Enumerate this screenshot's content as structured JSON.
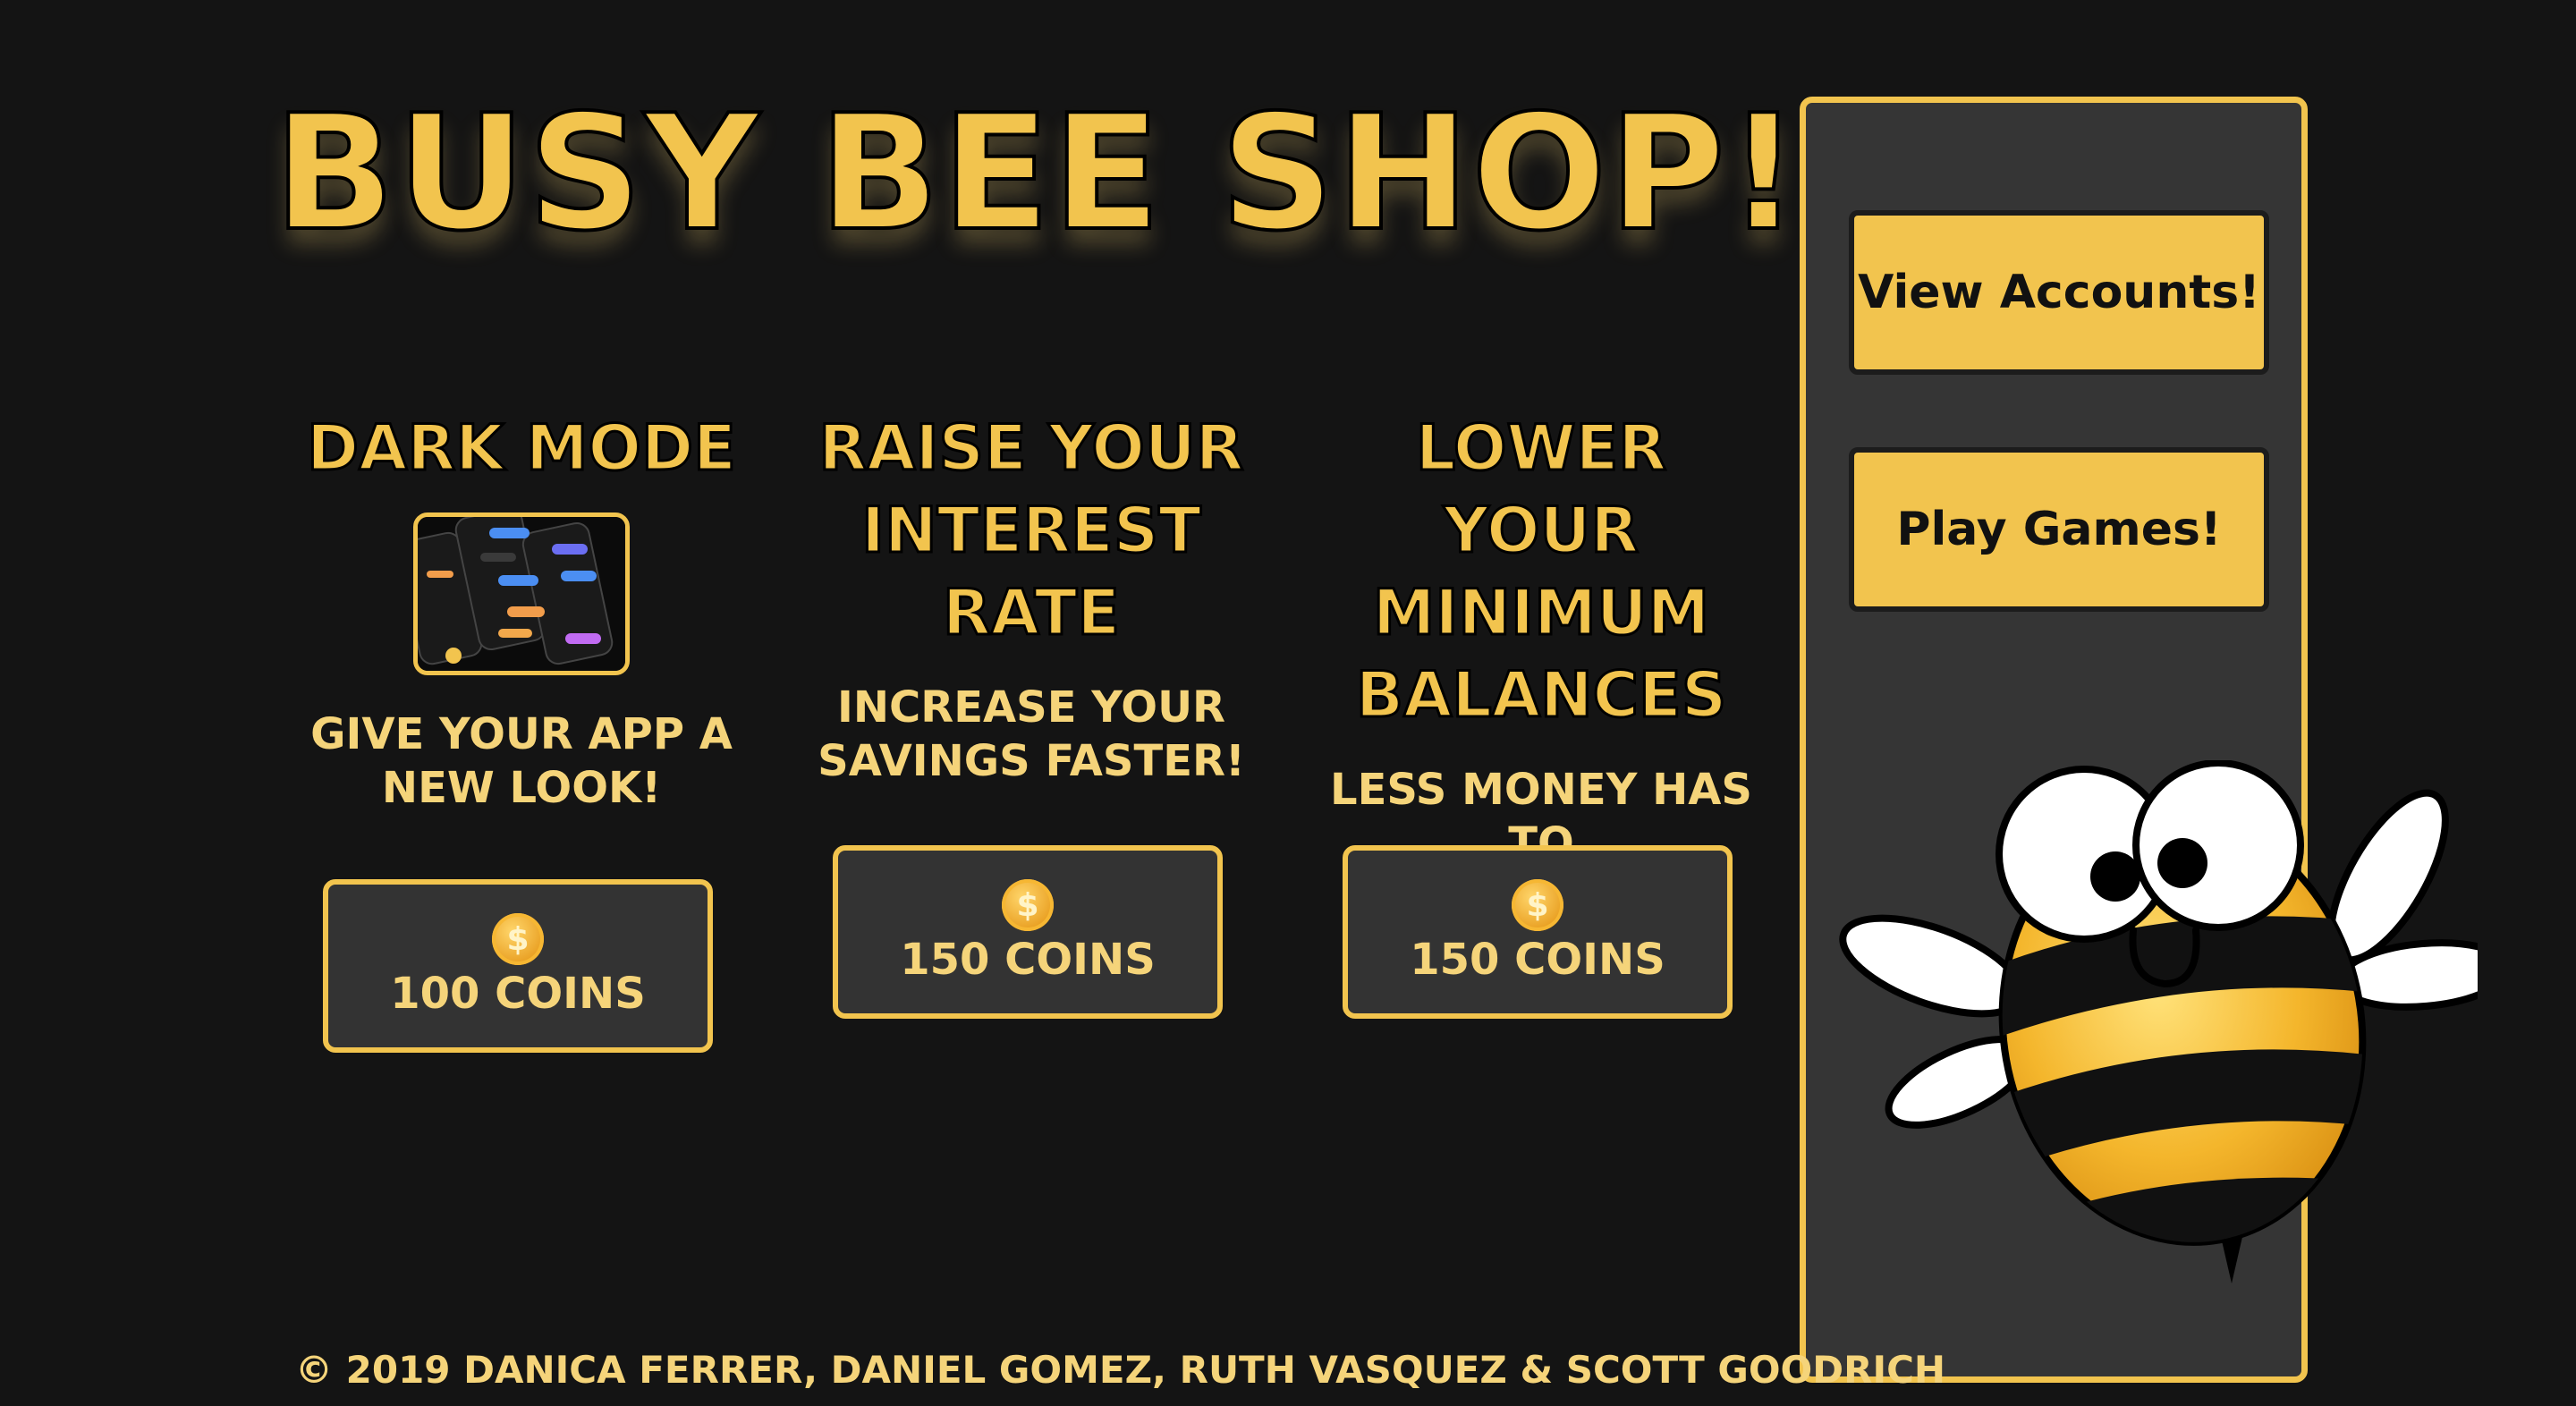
{
  "title": "BUSY BEE SHOP!",
  "products": [
    {
      "title": "DARK MODE",
      "description": "GIVE YOUR APP A\nNEW LOOK!",
      "price": "100 COINS",
      "coin_symbol": "$"
    },
    {
      "title": "RAISE YOUR\nINTEREST\nRATE",
      "description": "INCREASE YOUR\nSAVINGS FASTER!",
      "price": "150 COINS",
      "coin_symbol": "$"
    },
    {
      "title": "LOWER YOUR\nMINIMUM\nBALANCES",
      "description": "LESS MONEY HAS TO\nSTAY IN THE BANK!",
      "price": "150 COINS",
      "coin_symbol": "$"
    }
  ],
  "sidebar": {
    "view_accounts": "View Accounts!",
    "play_games": "Play Games!"
  },
  "footer": "© 2019 DANICA FERRER, DANIEL GOMEZ, RUTH VASQUEZ & SCOTT GOODRICH",
  "colors": {
    "background": "#141414",
    "accent": "#f2c44e",
    "panel": "#353535"
  },
  "icons": [
    "coin-icon",
    "bee-mascot",
    "dark-mode-thumbnail"
  ]
}
